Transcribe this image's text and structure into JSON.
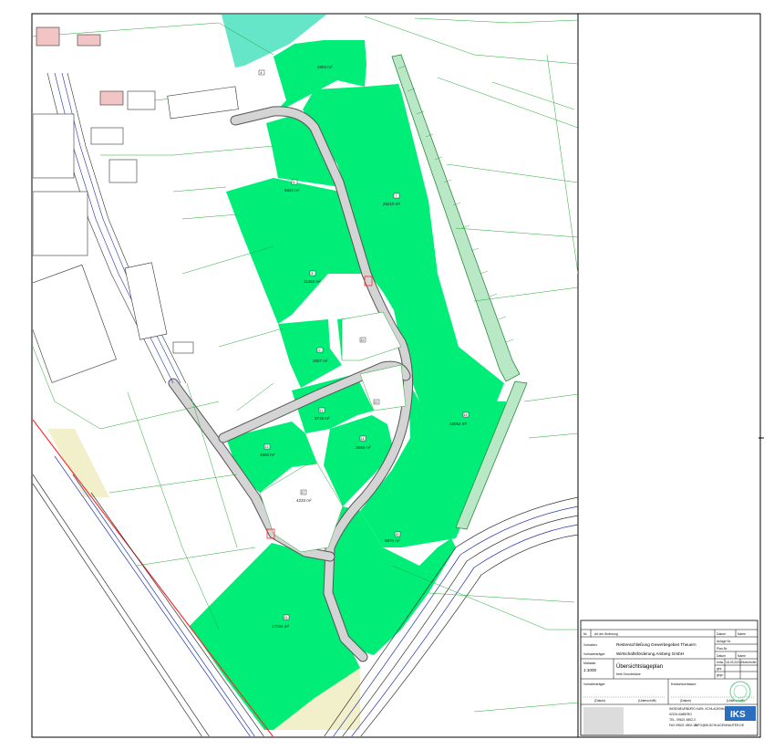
{
  "plan": {
    "area_labels": [
      "4803 m²",
      "6824 m²",
      "25210 m²",
      "11282 m²",
      "2607 m²",
      "3735 m²",
      "4800 m²",
      "3846 m²",
      "16052 m²",
      "4233 m²",
      "5970 m²",
      "17004 m²"
    ],
    "plot_numbers": [
      "4",
      "6",
      "7",
      "8",
      "9",
      "10",
      "11",
      "12",
      "13",
      "14",
      "15",
      "17",
      "20",
      "21"
    ]
  },
  "title_block": {
    "rev_no": "Nr.",
    "rev_type": "Art der Änderung",
    "col_date": "Datum",
    "col_name": "Name",
    "anlage_label": "Anlage Nr.",
    "plan_nr_label": "Plan-Nr.",
    "vorhaben_label": "Vorhaben:",
    "vorhaben": "Restenschließung Gewerbegebiet Theuern",
    "vorhabentraeger_label": "Vorhabenträger:",
    "vorhabentraeger": "Wirtschaftsförderung Amberg GmbH",
    "plan_title": "Übersichtslageplan",
    "plan_subtitle": "freie Grundstücke",
    "massstab_label": "Maßstab:",
    "massstab": "1:1000",
    "entw_label": "entw.",
    "entw_date": "18.03.2024",
    "entw_name": "Hinterhofer",
    "gez_label": "gez.",
    "gepr_label": "gepr.",
    "vorhabentraeger_sig": "Vorhabenträger:",
    "entwurfsverfasser_sig": "Entwurfsverfasser:",
    "datum": "(Datum)",
    "unterschrift": "(Unterschrift)",
    "office_name": "INGENIEURBÜRO KARL SCHLAGENHAUFER",
    "office_city": "92224 AMBERG",
    "office_tel": "TEL. 09621 4802-0",
    "office_fax": "FAX 09621 4802-13",
    "office_mail": "INFO@IB-SCHLAGENHAUFER.DE",
    "logo_text": "IKS"
  },
  "colors": {
    "free_plot": "#00ee77",
    "water": "#66e6c8",
    "road": "#d4d4d4",
    "parcel_line": "#22aa33",
    "building_line": "#333333",
    "rail_line": "#ff2222",
    "verge": "#f2efcb"
  }
}
